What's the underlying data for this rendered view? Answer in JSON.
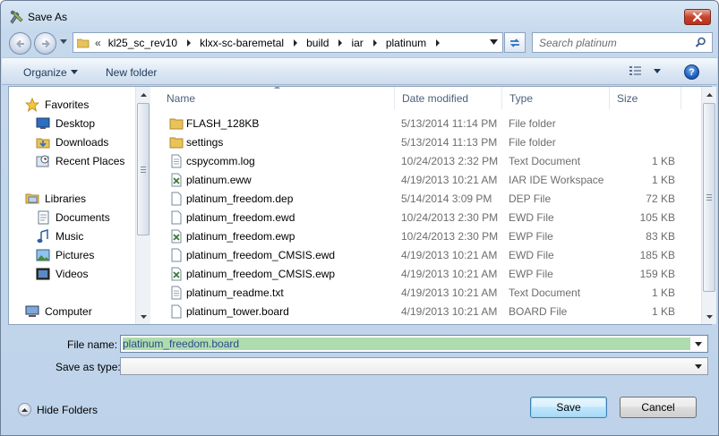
{
  "window": {
    "title": "Save As"
  },
  "address": {
    "overflow": "«",
    "crumbs": [
      "kl25_sc_rev10",
      "klxx-sc-baremetal",
      "build",
      "iar",
      "platinum"
    ]
  },
  "search": {
    "placeholder": "Search platinum"
  },
  "toolbar": {
    "organize_label": "Organize",
    "new_folder_label": "New folder",
    "help_label": "?"
  },
  "nav": {
    "items": [
      {
        "label": "Favorites",
        "icon": "star-icon"
      },
      {
        "label": "Desktop",
        "icon": "desktop-icon"
      },
      {
        "label": "Downloads",
        "icon": "downloads-folder-icon"
      },
      {
        "label": "Recent Places",
        "icon": "recent-places-icon"
      },
      {
        "label": "Libraries",
        "icon": "libraries-icon"
      },
      {
        "label": "Documents",
        "icon": "documents-icon"
      },
      {
        "label": "Music",
        "icon": "music-icon"
      },
      {
        "label": "Pictures",
        "icon": "pictures-icon"
      },
      {
        "label": "Videos",
        "icon": "videos-icon"
      },
      {
        "label": "Computer",
        "icon": "computer-icon"
      }
    ]
  },
  "files": {
    "columns": [
      "Name",
      "Date modified",
      "Type",
      "Size"
    ],
    "rows": [
      {
        "name": "FLASH_128KB",
        "date": "5/13/2014 11:14 PM",
        "type": "File folder",
        "size": "",
        "icon": "folder-icon"
      },
      {
        "name": "settings",
        "date": "5/13/2014 11:13 PM",
        "type": "File folder",
        "size": "",
        "icon": "folder-icon"
      },
      {
        "name": "cspycomm.log",
        "date": "10/24/2013 2:32 PM",
        "type": "Text Document",
        "size": "1 KB",
        "icon": "text-file-icon"
      },
      {
        "name": "platinum.eww",
        "date": "4/19/2013 10:21 AM",
        "type": "IAR IDE Workspace",
        "size": "1 KB",
        "icon": "iar-file-icon"
      },
      {
        "name": "platinum_freedom.dep",
        "date": "5/14/2014 3:09 PM",
        "type": "DEP File",
        "size": "72 KB",
        "icon": "blank-file-icon"
      },
      {
        "name": "platinum_freedom.ewd",
        "date": "10/24/2013 2:30 PM",
        "type": "EWD File",
        "size": "105 KB",
        "icon": "blank-file-icon"
      },
      {
        "name": "platinum_freedom.ewp",
        "date": "10/24/2013 2:30 PM",
        "type": "EWP File",
        "size": "83 KB",
        "icon": "iar-file-icon"
      },
      {
        "name": "platinum_freedom_CMSIS.ewd",
        "date": "4/19/2013 10:21 AM",
        "type": "EWD File",
        "size": "185 KB",
        "icon": "blank-file-icon"
      },
      {
        "name": "platinum_freedom_CMSIS.ewp",
        "date": "4/19/2013 10:21 AM",
        "type": "EWP File",
        "size": "159 KB",
        "icon": "iar-file-icon"
      },
      {
        "name": "platinum_readme.txt",
        "date": "4/19/2013 10:21 AM",
        "type": "Text Document",
        "size": "1 KB",
        "icon": "text-file-icon"
      },
      {
        "name": "platinum_tower.board",
        "date": "4/19/2013 10:21 AM",
        "type": "BOARD File",
        "size": "1 KB",
        "icon": "blank-file-icon"
      }
    ]
  },
  "form": {
    "file_name_label": "File name:",
    "file_name_value": "platinum_freedom.board",
    "save_as_type_label": "Save as type:",
    "save_as_type_value": ""
  },
  "footer": {
    "hide_folders_label": "Hide Folders",
    "save_label": "Save",
    "cancel_label": "Cancel"
  }
}
